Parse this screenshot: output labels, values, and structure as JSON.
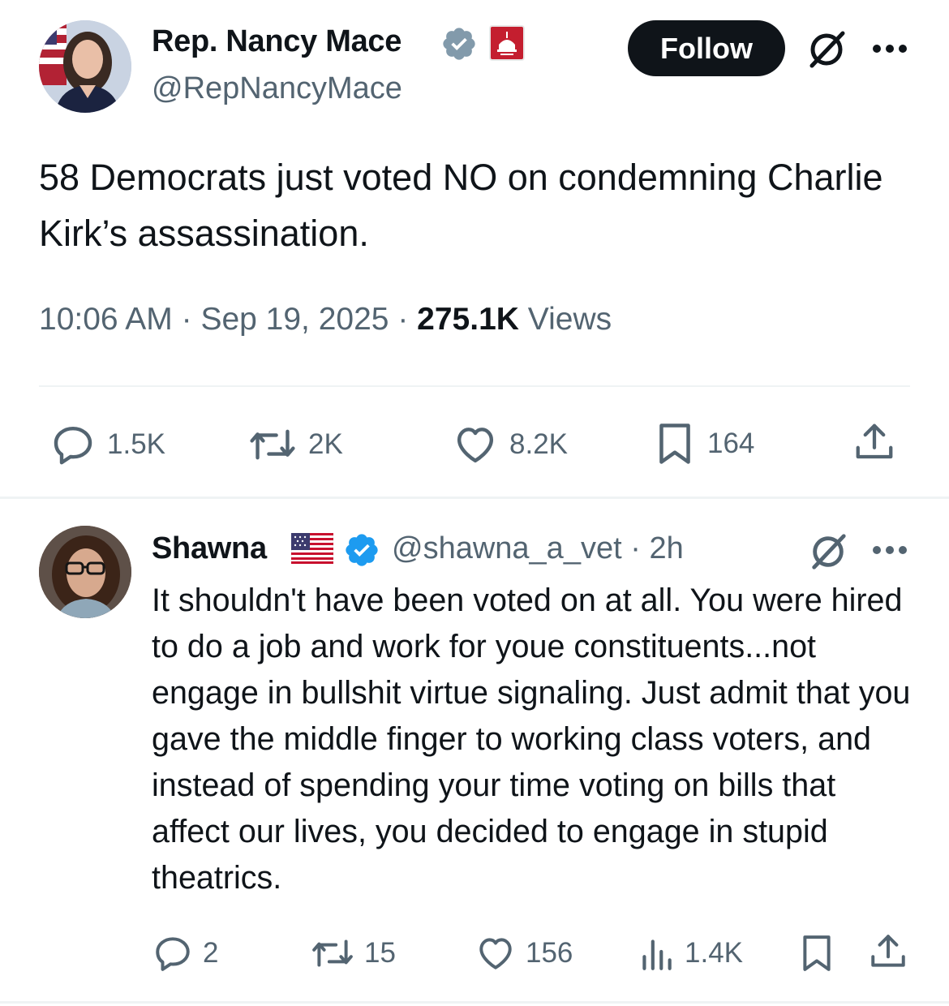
{
  "tweet": {
    "author_name": "Rep. Nancy Mace",
    "author_handle": "@RepNancyMace",
    "follow_label": "Follow",
    "text": "58 Democrats just voted NO on condemning Charlie Kirk’s assassination.",
    "time": "10:06 AM",
    "date": "Sep 19, 2025",
    "views_count": "275.1K",
    "views_label": "Views",
    "separator": " · ",
    "stats": {
      "replies": "1.5K",
      "reposts": "2K",
      "likes": "8.2K",
      "bookmarks": "164"
    },
    "icons": [
      "verified-badge-icon",
      "government-affiliation-icon",
      "grok-icon",
      "more-icon",
      "reply-icon",
      "repost-icon",
      "like-icon",
      "bookmark-icon",
      "share-icon"
    ]
  },
  "reply": {
    "author_name": "Shawna",
    "author_handle": "@shawna_a_vet",
    "time_ago": "2h",
    "separator": " · ",
    "text": "It shouldn't have been voted on at all. You were hired to do a job and work for youe constituents...not engage in bullshit virtue signaling. Just admit that you gave the middle finger to working class voters, and instead of spending your time voting on bills that affect our lives, you decided to engage in stupid theatrics.",
    "stats": {
      "replies": "2",
      "reposts": "15",
      "likes": "156",
      "views": "1.4K"
    },
    "icons": [
      "us-flag-icon",
      "verified-badge-icon",
      "grok-icon",
      "more-icon",
      "reply-icon",
      "repost-icon",
      "like-icon",
      "views-icon",
      "bookmark-icon",
      "share-icon"
    ]
  },
  "colors": {
    "text_primary": "#0f1419",
    "text_secondary": "#536471",
    "verified_blue": "#1d9bf0",
    "verified_grey": "#829aab",
    "gov_red": "#c41e2f",
    "divider": "#eff3f4",
    "button_bg": "#0f1419"
  }
}
